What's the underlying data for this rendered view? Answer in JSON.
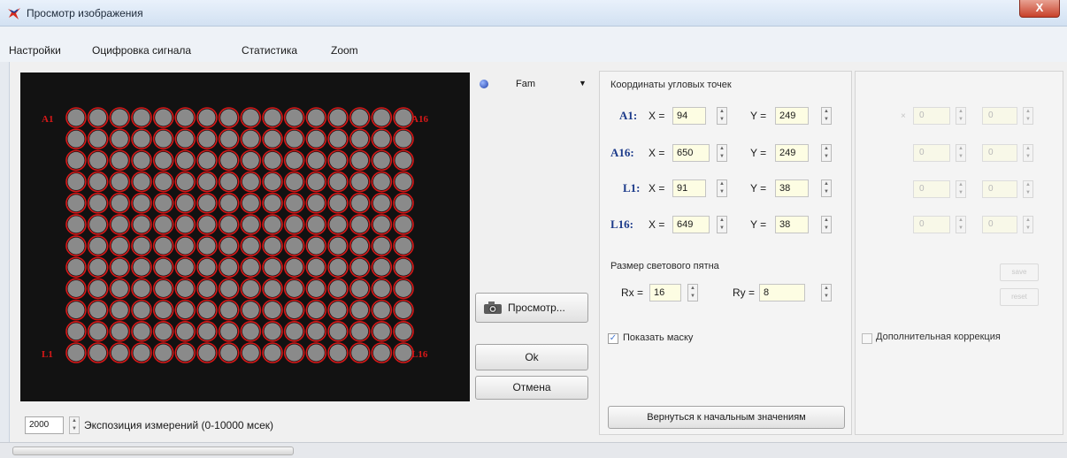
{
  "window": {
    "title": "Просмотр изображения",
    "close_glyph": "X",
    "icon": "app-logo-icon"
  },
  "menu": [
    "Настройки",
    "Оцифровка сигнала",
    "Статистика",
    "Zoom"
  ],
  "plate": {
    "rows": 12,
    "cols": 16,
    "well_color": "#8a8a8a",
    "mask_color": "#d81818",
    "corner_labels": {
      "top_left": "A1",
      "top_right": "A16",
      "bottom_left": "L1",
      "bottom_right": "L16"
    }
  },
  "exposure": {
    "value": "2000",
    "label": "Экспозиция измерений (0-10000 мсек)"
  },
  "dye": {
    "name": "Fam",
    "icon": "blue-dot-icon"
  },
  "buttons": {
    "preview": "Просмотр...",
    "ok": "Ok",
    "cancel": "Отмена",
    "reset": "Вернуться к начальным значениям"
  },
  "coords": {
    "title": "Координаты угловых точек",
    "points": [
      {
        "name": "A1:",
        "x": "94",
        "y": "249"
      },
      {
        "name": "A16:",
        "x": "650",
        "y": "249"
      },
      {
        "name": "L1:",
        "x": "91",
        "y": "38"
      },
      {
        "name": "L16:",
        "x": "649",
        "y": "38"
      }
    ],
    "x_label": "X =",
    "y_label": "Y ="
  },
  "spot": {
    "title": "Размер светового пятна",
    "rx_label": "Rx =",
    "rx": "16",
    "ry_label": "Ry =",
    "ry": "8"
  },
  "show_mask": {
    "label": "Показать маску",
    "checked": true
  },
  "extra": {
    "rows": [
      {
        "a": "0",
        "b": "0"
      },
      {
        "a": "0",
        "b": "0"
      },
      {
        "a": "0",
        "b": "0"
      },
      {
        "a": "0",
        "b": "0"
      }
    ],
    "btn1": "save",
    "btn2": "reset",
    "checkbox_label": "Дополнительная коррекция",
    "checked": false
  }
}
